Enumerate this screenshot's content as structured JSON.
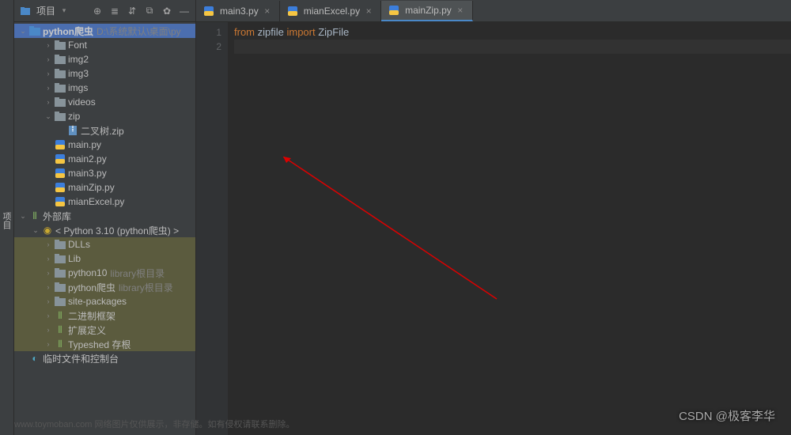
{
  "leftGutter": "项目",
  "toolbar": {
    "title": "项目"
  },
  "tree": {
    "root": {
      "name": "python爬虫",
      "path": "D:\\系统默认\\桌面\\py"
    },
    "items": [
      {
        "label": "Font",
        "type": "folder",
        "depth": 2,
        "expand": "closed"
      },
      {
        "label": "img2",
        "type": "folder",
        "depth": 2,
        "expand": "closed"
      },
      {
        "label": "img3",
        "type": "folder",
        "depth": 2,
        "expand": "closed"
      },
      {
        "label": "imgs",
        "type": "folder",
        "depth": 2,
        "expand": "closed"
      },
      {
        "label": "videos",
        "type": "folder",
        "depth": 2,
        "expand": "closed"
      },
      {
        "label": "zip",
        "type": "folder",
        "depth": 2,
        "expand": "open"
      },
      {
        "label": "二叉树.zip",
        "type": "zip",
        "depth": 3,
        "expand": "none"
      },
      {
        "label": "main.py",
        "type": "py",
        "depth": 2,
        "expand": "none"
      },
      {
        "label": "main2.py",
        "type": "py",
        "depth": 2,
        "expand": "none"
      },
      {
        "label": "main3.py",
        "type": "py",
        "depth": 2,
        "expand": "none"
      },
      {
        "label": "mainZip.py",
        "type": "py",
        "depth": 2,
        "expand": "none"
      },
      {
        "label": "mianExcel.py",
        "type": "py",
        "depth": 2,
        "expand": "none"
      }
    ],
    "externalLib": "外部库",
    "pyenv": {
      "prefix": "< Python 3.10 (python爬虫) >"
    },
    "envItems": [
      {
        "label": "DLLs",
        "type": "folder",
        "suffix": ""
      },
      {
        "label": "Lib",
        "type": "folder",
        "suffix": ""
      },
      {
        "label": "python10",
        "type": "folder",
        "suffix": "library根目录"
      },
      {
        "label": "python爬虫",
        "type": "folder",
        "suffix": "library根目录"
      },
      {
        "label": "site-packages",
        "type": "folder",
        "suffix": ""
      },
      {
        "label": "二进制框架",
        "type": "lib",
        "suffix": ""
      },
      {
        "label": "扩展定义",
        "type": "lib",
        "suffix": ""
      },
      {
        "label": "Typeshed 存根",
        "type": "lib",
        "suffix": ""
      }
    ],
    "scratch": "临时文件和控制台"
  },
  "tabs": [
    {
      "label": "main3.py",
      "active": false
    },
    {
      "label": "mianExcel.py",
      "active": false
    },
    {
      "label": "mainZip.py",
      "active": true
    }
  ],
  "code": {
    "lines": [
      "1",
      "2"
    ],
    "content": [
      {
        "tokens": [
          {
            "t": "from ",
            "c": "kw"
          },
          {
            "t": "zipfile ",
            "c": "txt"
          },
          {
            "t": "import ",
            "c": "kw"
          },
          {
            "t": "ZipFile",
            "c": "txt"
          }
        ]
      },
      {
        "tokens": []
      }
    ]
  },
  "watermark": "CSDN @极客李华",
  "footerWatermark": "www.toymoban.com 网络图片仅供展示，非存储。如有侵权请联系删除。"
}
